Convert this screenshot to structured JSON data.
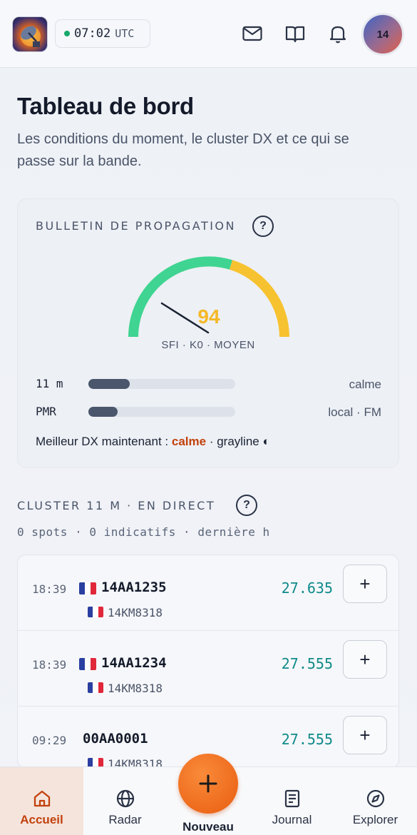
{
  "header": {
    "clock_time": "07:02",
    "clock_zone": "UTC",
    "avatar_text": "14",
    "icons": [
      "mail-icon",
      "book-icon",
      "bell-icon"
    ],
    "status_color": "#17a86a"
  },
  "page": {
    "title": "Tableau de bord",
    "subtitle": "Les conditions du moment, le cluster DX et ce qui se passe sur la bande."
  },
  "propagation": {
    "label": "BULLETIN DE PROPAGATION",
    "help": "?",
    "gauge_value": "94",
    "gauge_caption": "SFI · K0 · MOYEN",
    "bands": [
      {
        "name": "11 m",
        "level": 0.28,
        "status": "calme"
      },
      {
        "name": "PMR",
        "level": 0.2,
        "status": "local · FM"
      }
    ],
    "best_dx_prefix": "Meilleur DX maintenant :",
    "best_dx_value": "calme",
    "best_dx_suffix": "· grayline ◐"
  },
  "cluster": {
    "label": "CLUSTER 11 M · EN DIRECT",
    "help": "?",
    "meta": "0 spots · 0 indicatifs · dernière h",
    "spots": [
      {
        "time": "18:39",
        "callsign": "14AA1235",
        "has_flag": true,
        "reporter": "14KM8318",
        "freq": "27.635",
        "add": "+"
      },
      {
        "time": "18:39",
        "callsign": "14AA1234",
        "has_flag": true,
        "reporter": "14KM8318",
        "freq": "27.555",
        "add": "+"
      },
      {
        "time": "09:29",
        "callsign": "00AA0001",
        "has_flag": false,
        "reporter": "14KM8318",
        "freq": "27.555",
        "add": "+"
      }
    ]
  },
  "nav": {
    "items": [
      {
        "label": "Accueil",
        "icon": "home-icon",
        "active": true
      },
      {
        "label": "Radar",
        "icon": "globe-icon"
      },
      {
        "label": "Nouveau",
        "icon": "plus-icon"
      },
      {
        "label": "Journal",
        "icon": "journal-icon"
      },
      {
        "label": "Explorer",
        "icon": "compass-icon"
      }
    ],
    "accent": "#c2410c"
  }
}
